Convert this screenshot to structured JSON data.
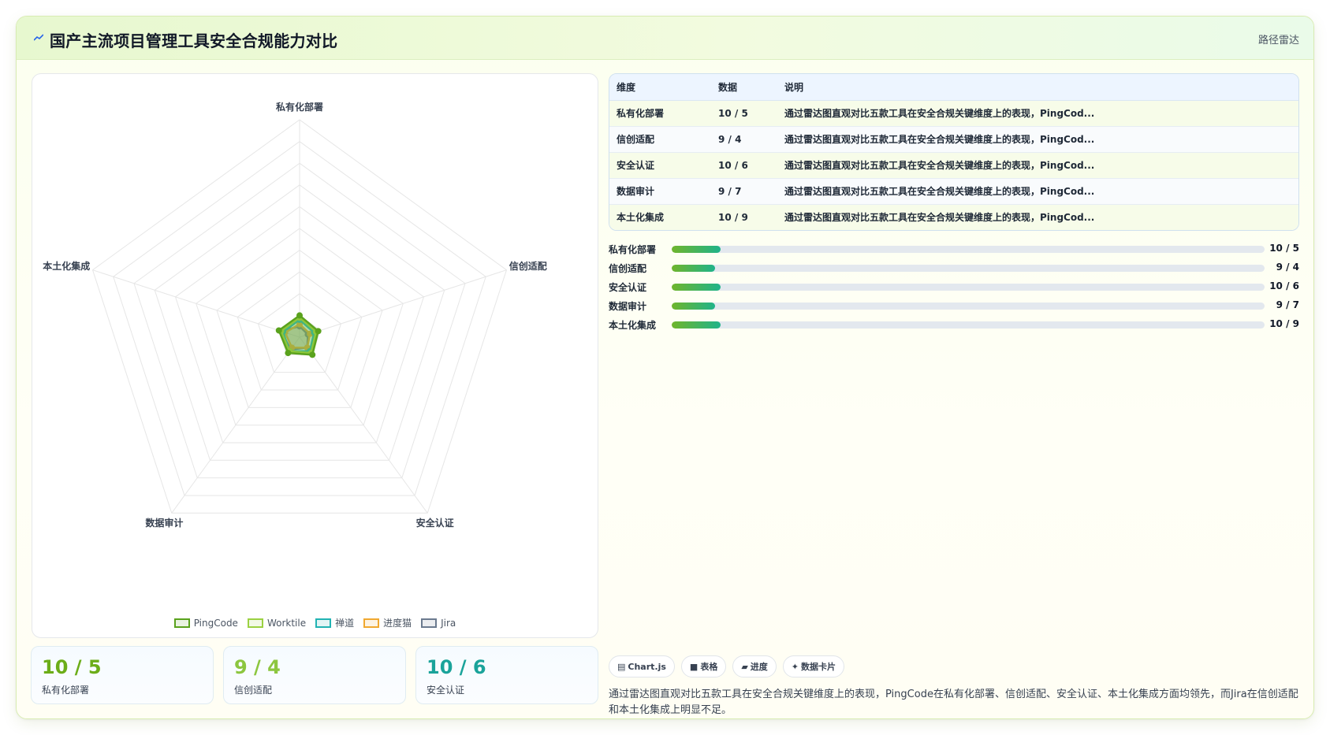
{
  "header": {
    "title": "国产主流项目管理工具安全合规能力对比",
    "tag": "路径雷达",
    "logo_icon": "chart-trend-icon"
  },
  "chart_data": {
    "type": "radar",
    "axes": [
      "私有化部署",
      "信创适配",
      "安全认证",
      "数据审计",
      "本土化集成"
    ],
    "rmax": 100,
    "grid_levels": 10,
    "series": [
      {
        "name": "PingCode",
        "color": "#5aa21d",
        "values": [
          10,
          9,
          10,
          9,
          10
        ]
      },
      {
        "name": "Worktile",
        "color": "#9bd142",
        "values": [
          9,
          8,
          9,
          8,
          9
        ]
      },
      {
        "name": "禅道",
        "color": "#22b3b3",
        "values": [
          8,
          7,
          8,
          8,
          8
        ]
      },
      {
        "name": "进度猫",
        "color": "#f0a830",
        "values": [
          6,
          5,
          6,
          6,
          7
        ]
      },
      {
        "name": "Jira",
        "color": "#6b7a8f",
        "values": [
          5,
          4,
          6,
          7,
          9
        ]
      }
    ]
  },
  "stats": [
    {
      "value": "10 / 5",
      "label": "私有化部署",
      "color": "#6cad18"
    },
    {
      "value": "9 / 4",
      "label": "信创适配",
      "color": "#8cc63f"
    },
    {
      "value": "10 / 6",
      "label": "安全认证",
      "color": "#1aa39a"
    }
  ],
  "table": {
    "headers": [
      "维度",
      "数据",
      "说明"
    ],
    "rows": [
      {
        "dim": "私有化部署",
        "data": "10 / 5",
        "desc": "通过雷达图直观对比五款工具在安全合规关键维度上的表现，PingCod..."
      },
      {
        "dim": "信创适配",
        "data": "9 / 4",
        "desc": "通过雷达图直观对比五款工具在安全合规关键维度上的表现，PingCod..."
      },
      {
        "dim": "安全认证",
        "data": "10 / 6",
        "desc": "通过雷达图直观对比五款工具在安全合规关键维度上的表现，PingCod..."
      },
      {
        "dim": "数据审计",
        "data": "9 / 7",
        "desc": "通过雷达图直观对比五款工具在安全合规关键维度上的表现，PingCod..."
      },
      {
        "dim": "本土化集成",
        "data": "10 / 9",
        "desc": "通过雷达图直观对比五款工具在安全合规关键维度上的表现，PingCod..."
      }
    ]
  },
  "progress": [
    {
      "label": "私有化部署",
      "value": "10 / 5",
      "fill": 0.082
    },
    {
      "label": "信创适配",
      "value": "9 / 4",
      "fill": 0.073
    },
    {
      "label": "安全认证",
      "value": "10 / 6",
      "fill": 0.082
    },
    {
      "label": "数据审计",
      "value": "9 / 7",
      "fill": 0.073
    },
    {
      "label": "本土化集成",
      "value": "10 / 9",
      "fill": 0.082
    }
  ],
  "chips": [
    {
      "icon": "chart-icon",
      "glyph": "▤",
      "label": "Chart.js"
    },
    {
      "icon": "table-icon",
      "glyph": "■",
      "label": "表格"
    },
    {
      "icon": "progress-icon",
      "glyph": "▰",
      "label": "进度"
    },
    {
      "icon": "sparkle-icon",
      "glyph": "✦",
      "label": "数据卡片"
    }
  ],
  "description": "通过雷达图直观对比五款工具在安全合规关键维度上的表现，PingCode在私有化部署、信创适配、安全认证、本土化集成方面均领先，而Jira在信创适配和本土化集成上明显不足。"
}
